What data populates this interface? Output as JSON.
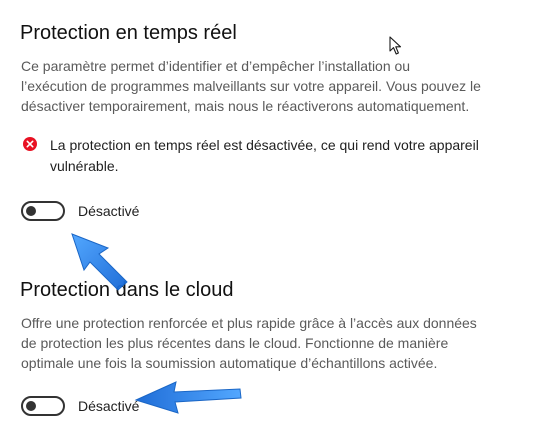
{
  "realtime": {
    "title": "Protection en temps réel",
    "description_lines": [
      "Ce paramètre permet d’identifier et d’empêcher l’installation ou",
      "l’exécution de programmes malveillants sur votre appareil. Vous pouvez le",
      "désactiver temporairement, mais nous le réactiverons automatiquement."
    ],
    "warning_lines": [
      "La protection en temps réel est désactivée, ce qui rend votre appareil",
      "vulnérable."
    ],
    "toggle_label": "Désactivé",
    "toggle_on": false
  },
  "cloud": {
    "title": "Protection dans le cloud",
    "description_lines": [
      "Offre une protection renforcée et plus rapide grâce à l’accès aux données",
      "de protection les plus récentes dans le cloud. Fonctionne de manière",
      "optimale une fois la soumission automatique d’échantillons activée."
    ],
    "toggle_label": "Désactivé",
    "toggle_on": false
  },
  "colors": {
    "error": "#e81123",
    "annotation_arrow": "#1e7ae0",
    "toggle_off": "#333333"
  },
  "icons": {
    "warning": "error-circle-x-icon",
    "cursor": "mouse-pointer-icon",
    "annotation": "blue-arrow-annotation"
  }
}
